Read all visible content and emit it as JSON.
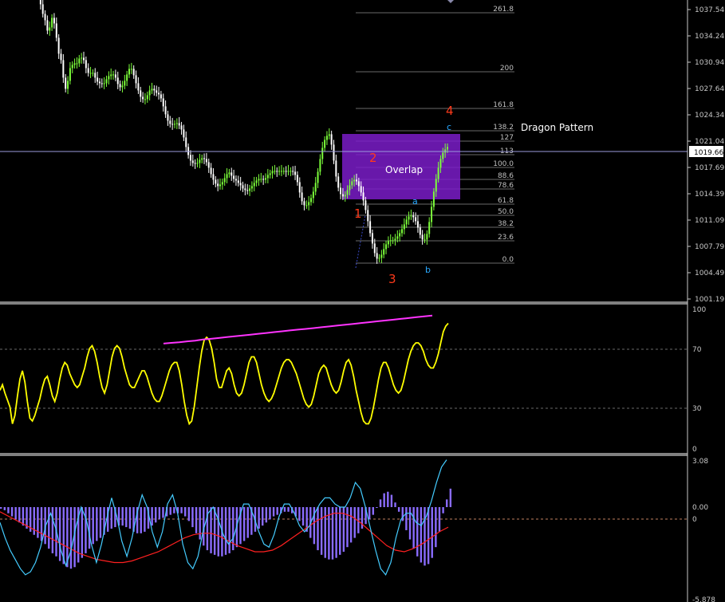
{
  "colors": {
    "background": "#000000",
    "axis": "#c8c8c8",
    "bull_candle": "#7cff3a",
    "bear_candle": "#ffffff",
    "fib_line": "#6a6a6a",
    "fib_label": "#c0c0c0",
    "overlap_box": "#7a1cc8",
    "wave_major": "#ff3a1a",
    "wave_minor": "#29a8ff",
    "rsi_line": "#ffff00",
    "divergence_line": "#ff33ff",
    "histogram": "#8a6cff",
    "signal_line": "#ff2020",
    "osc_line": "#44ccff",
    "price_marker_bg": "#ffffff"
  },
  "price_panel": {
    "y_ticks": [
      "1037.54",
      "1034.24",
      "1030.94",
      "1027.64",
      "1024.34",
      "1021.04",
      "1017.69",
      "1014.39",
      "1011.09",
      "1007.79",
      "1004.49",
      "1001.19"
    ],
    "current_price": "1019.66",
    "pattern_title": "Dragon Pattern",
    "overlap_label": "Overlap",
    "fib_levels": [
      "261.8",
      "200",
      "161.8",
      "138.2",
      "127",
      "113",
      "100.0",
      "88.6",
      "78.6",
      "61.8",
      "50.0",
      "38.2",
      "23.6",
      "0.0"
    ],
    "wave_labels_major": [
      "1",
      "2",
      "3",
      "4"
    ],
    "wave_labels_minor": [
      "a",
      "b",
      "c"
    ]
  },
  "rsi_panel": {
    "y_ticks": [
      "100",
      "70",
      "30",
      "0"
    ]
  },
  "macd_panel": {
    "y_ticks": [
      "3.08",
      "0.00",
      "0",
      "-5.878"
    ]
  },
  "chart_data": [
    {
      "type": "candlestick",
      "title": "",
      "ylim": [
        1001.19,
        1040.0
      ],
      "close": [
        1039.6,
        1038.2,
        1037.0,
        1036.2,
        1034.9,
        1035.3,
        1036.5,
        1035.8,
        1034.0,
        1032.0,
        1031.2,
        1029.0,
        1027.6,
        1028.6,
        1030.2,
        1030.6,
        1030.8,
        1030.8,
        1031.4,
        1031.5,
        1031.2,
        1030.2,
        1029.6,
        1029.6,
        1029.6,
        1029.0,
        1028.5,
        1028.3,
        1028.2,
        1028.3,
        1028.8,
        1029.2,
        1029.4,
        1029.4,
        1029.0,
        1028.2,
        1027.8,
        1028.0,
        1028.6,
        1029.4,
        1030.1,
        1030.1,
        1029.3,
        1028.3,
        1027.4,
        1026.6,
        1026.3,
        1026.3,
        1026.8,
        1027.4,
        1027.6,
        1027.4,
        1027.1,
        1026.9,
        1026.4,
        1025.4,
        1024.4,
        1023.6,
        1023.2,
        1023.1,
        1023.2,
        1023.3,
        1023.0,
        1022.5,
        1021.5,
        1020.3,
        1019.3,
        1018.6,
        1018.3,
        1018.2,
        1018.3,
        1018.7,
        1018.9,
        1018.8,
        1018.4,
        1017.7,
        1016.9,
        1016.2,
        1015.7,
        1015.4,
        1015.6,
        1015.9,
        1016.4,
        1016.9,
        1017.1,
        1016.7,
        1016.3,
        1016.1,
        1015.8,
        1015.5,
        1015.1,
        1014.9,
        1014.8,
        1015.1,
        1015.4,
        1015.8,
        1016.1,
        1016.3,
        1016.3,
        1016.2,
        1016.4,
        1016.8,
        1017.0,
        1017.3,
        1017.3,
        1017.2,
        1017.3,
        1017.3,
        1017.3,
        1017.2,
        1017.3,
        1017.3,
        1017.2,
        1016.8,
        1015.9,
        1014.6,
        1013.5,
        1013.0,
        1013.0,
        1013.4,
        1013.9,
        1014.7,
        1015.8,
        1017.2,
        1018.8,
        1020.2,
        1021.2,
        1021.7,
        1021.9,
        1020.6,
        1018.6,
        1016.6,
        1015.2,
        1014.4,
        1014.1,
        1014.3,
        1014.9,
        1015.5,
        1016.0,
        1016.2,
        1016.0,
        1015.4,
        1014.6,
        1013.6,
        1012.4,
        1011.0,
        1009.5,
        1008.2,
        1007.0,
        1006.3,
        1006.4,
        1006.8,
        1007.5,
        1008.1,
        1008.5,
        1008.6,
        1008.6,
        1008.8,
        1009.1,
        1009.5,
        1010.0,
        1010.6,
        1011.2,
        1011.6,
        1011.7,
        1011.5,
        1011.0,
        1010.2,
        1009.3,
        1008.7,
        1008.7,
        1009.4,
        1010.9,
        1012.8,
        1014.7,
        1016.3,
        1017.7,
        1018.8,
        1019.6,
        1020.0,
        1020.3
      ]
    },
    {
      "type": "line",
      "title": "",
      "ylim": [
        0,
        100
      ],
      "series": [
        {
          "values": [
            42,
            46,
            40,
            35,
            30,
            18,
            24,
            38,
            50,
            56,
            48,
            34,
            22,
            20,
            24,
            30,
            36,
            44,
            50,
            52,
            46,
            38,
            34,
            40,
            50,
            58,
            62,
            60,
            54,
            50,
            46,
            44,
            46,
            52,
            58,
            66,
            72,
            74,
            70,
            62,
            52,
            44,
            40,
            46,
            56,
            66,
            72,
            74,
            72,
            66,
            58,
            52,
            46,
            44,
            44,
            48,
            52,
            56,
            56,
            52,
            46,
            40,
            36,
            34,
            34,
            38,
            44,
            50,
            56,
            60,
            62,
            62,
            56,
            46,
            34,
            24,
            18,
            20,
            30,
            44,
            58,
            70,
            78,
            80,
            78,
            72,
            62,
            50,
            44,
            44,
            50,
            56,
            58,
            54,
            46,
            40,
            38,
            40,
            46,
            54,
            62,
            66,
            66,
            62,
            54,
            46,
            40,
            36,
            34,
            36,
            40,
            46,
            52,
            58,
            62,
            64,
            64,
            62,
            58,
            54,
            48,
            42,
            36,
            32,
            30,
            32,
            38,
            46,
            54,
            58,
            60,
            58,
            52,
            46,
            42,
            40,
            42,
            48,
            56,
            62,
            64,
            60,
            52,
            42,
            34,
            26,
            20,
            18,
            18,
            22,
            30,
            40,
            50,
            58,
            62,
            62,
            58,
            52,
            46,
            42,
            40,
            42,
            48,
            56,
            64,
            70,
            74,
            76,
            76,
            74,
            70,
            64,
            60,
            58,
            58,
            62,
            68,
            76,
            84,
            88,
            90
          ]
        },
        {
          "values": [
            75.5,
            76.0,
            76.4,
            77.1,
            77.6,
            78.4,
            78.9,
            79.5,
            80.1,
            80.7,
            81.3,
            81.9,
            82.5,
            83.1,
            83.7,
            84.3,
            84.9,
            85.5,
            86.0,
            86.6,
            87.2,
            87.8,
            88.4,
            89.0,
            89.6,
            90.2,
            90.8,
            91.4,
            92.0,
            92.6,
            93.2,
            93.8,
            94.4,
            95.0,
            95.6
          ]
        }
      ]
    },
    {
      "type": "bar",
      "title": "",
      "ylim": [
        -5.878,
        3.08
      ],
      "series": [
        {
          "values": [
            -0.1,
            -0.2,
            -0.4,
            -0.6,
            -0.8,
            -1.0,
            -1.2,
            -1.4,
            -1.6,
            -1.8,
            -2.0,
            -2.2,
            -2.4,
            -2.7,
            -3.0,
            -3.2,
            -3.5,
            -3.7,
            -3.9,
            -4.0,
            -3.9,
            -3.6,
            -3.3,
            -3.0,
            -2.7,
            -2.4,
            -2.2,
            -2.0,
            -1.8,
            -1.6,
            -1.4,
            -1.3,
            -1.2,
            -1.2,
            -1.3,
            -1.4,
            -1.6,
            -1.7,
            -1.7,
            -1.6,
            -1.4,
            -1.2,
            -1.0,
            -0.8,
            -0.7,
            -0.6,
            -0.5,
            -0.4,
            -0.4,
            -0.4,
            -0.6,
            -0.9,
            -1.3,
            -1.7,
            -2.1,
            -2.5,
            -2.8,
            -3.0,
            -3.1,
            -3.2,
            -3.2,
            -3.1,
            -3.0,
            -2.8,
            -2.6,
            -2.4,
            -2.2,
            -2.0,
            -1.8,
            -1.6,
            -1.4,
            -1.2,
            -1.0,
            -0.8,
            -0.6,
            -0.5,
            -0.4,
            -0.3,
            -0.3,
            -0.4,
            -0.6,
            -0.9,
            -1.2,
            -1.6,
            -2.0,
            -2.4,
            -2.8,
            -3.1,
            -3.3,
            -3.4,
            -3.4,
            -3.3,
            -3.1,
            -2.9,
            -2.6,
            -2.3,
            -2.0,
            -1.7,
            -1.4,
            -1.1,
            -0.8,
            -0.5,
            0.0,
            0.5,
            0.9,
            1.0,
            0.8,
            0.3,
            -0.3,
            -0.9,
            -1.5,
            -2.1,
            -2.7,
            -3.2,
            -3.6,
            -3.8,
            -3.7,
            -3.3,
            -2.6,
            -1.6,
            -0.4,
            0.5,
            1.2
          ]
        },
        {
          "values": [
            -0.3,
            -0.6,
            -0.9,
            -1.2,
            -1.5,
            -1.8,
            -2.1,
            -2.4,
            -2.7,
            -3.0,
            -3.2,
            -3.4,
            -3.5,
            -3.6,
            -3.6,
            -3.5,
            -3.3,
            -3.1,
            -2.9,
            -2.6,
            -2.3,
            -2.0,
            -1.8,
            -1.7,
            -1.7,
            -1.9,
            -2.2,
            -2.5,
            -2.7,
            -2.9,
            -2.9,
            -2.8,
            -2.5,
            -2.1,
            -1.7,
            -1.3,
            -0.9,
            -0.6,
            -0.4,
            -0.4,
            -0.6,
            -1.0,
            -1.5,
            -2.0,
            -2.5,
            -2.8,
            -2.9,
            -2.7,
            -2.4,
            -2.0,
            -1.6,
            -1.3
          ]
        },
        {
          "values": [
            -1.0,
            -2.0,
            -2.8,
            -3.4,
            -4.0,
            -4.4,
            -4.2,
            -3.6,
            -2.6,
            -1.2,
            -0.4,
            -1.4,
            -2.8,
            -3.8,
            -2.8,
            -1.2,
            0.0,
            -0.8,
            -2.4,
            -3.6,
            -2.4,
            -0.8,
            0.6,
            -0.6,
            -2.2,
            -3.2,
            -2.0,
            -0.4,
            0.8,
            0.0,
            -1.6,
            -2.6,
            -1.6,
            0.2,
            0.8,
            -0.4,
            -2.4,
            -3.6,
            -4.0,
            -3.2,
            -1.6,
            -0.4,
            0.0,
            -0.8,
            -1.8,
            -2.4,
            -2.0,
            -0.8,
            0.2,
            0.2,
            -0.6,
            -1.6,
            -2.4,
            -2.6,
            -1.8,
            -0.6,
            0.2,
            0.2,
            -0.4,
            -1.2,
            -1.6,
            -1.2,
            -0.4,
            0.2,
            0.6,
            0.6,
            0.2,
            0.0,
            0.0,
            0.6,
            1.6,
            1.2,
            0.0,
            -1.4,
            -2.8,
            -4.0,
            -4.4,
            -3.6,
            -2.0,
            -0.8,
            -0.4,
            -0.4,
            -1.0,
            -1.2,
            -0.6,
            0.4,
            1.6,
            2.6,
            3.08
          ]
        }
      ]
    }
  ]
}
